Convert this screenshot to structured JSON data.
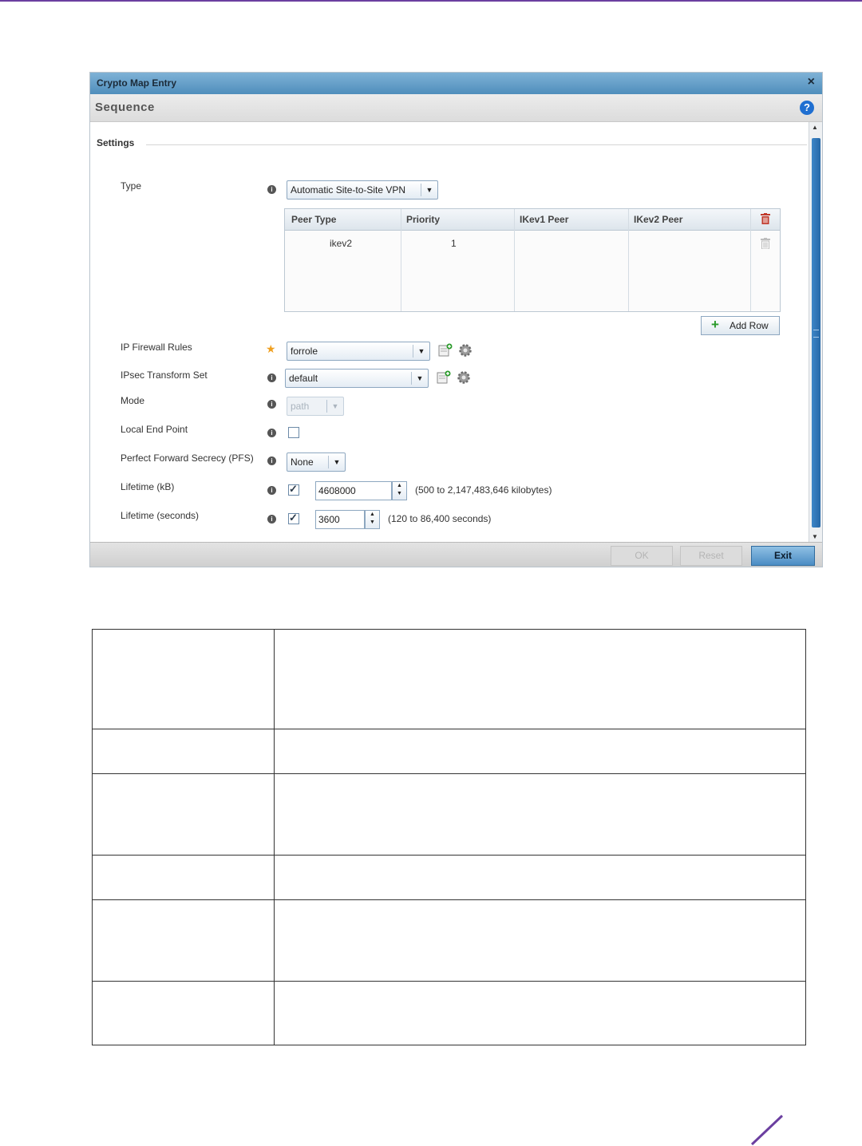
{
  "dialog": {
    "title": "Crypto Map Entry",
    "close_glyph": "×",
    "section_title": "Sequence",
    "help_glyph": "?",
    "settings_legend": "Settings"
  },
  "form": {
    "type": {
      "label": "Type",
      "value": "Automatic Site-to-Site VPN"
    },
    "peer_table": {
      "columns": [
        "Peer Type",
        "Priority",
        "IKev1 Peer",
        "IKev2 Peer"
      ],
      "rows": [
        {
          "peer_type": "ikev2",
          "priority": "1",
          "ikev1_peer": "",
          "ikev2_peer": ""
        }
      ]
    },
    "add_row_label": "Add Row",
    "ip_firewall_rules": {
      "label": "IP Firewall Rules",
      "value": "forrole"
    },
    "ipsec_transform_set": {
      "label": "IPsec Transform Set",
      "value": "default"
    },
    "mode": {
      "label": "Mode",
      "value": "path"
    },
    "local_end_point": {
      "label": "Local End Point",
      "checked": false
    },
    "pfs": {
      "label": "Perfect Forward Secrecy (PFS)",
      "value": "None"
    },
    "lifetime_kb": {
      "label": "Lifetime (kB)",
      "checked": true,
      "value": "4608000",
      "range": "(500 to 2,147,483,646 kilobytes)"
    },
    "lifetime_seconds": {
      "label": "Lifetime (seconds)",
      "checked": true,
      "value": "3600",
      "range": "(120 to 86,400 seconds)"
    }
  },
  "footer": {
    "ok_label": "OK",
    "reset_label": "Reset",
    "exit_label": "Exit"
  },
  "colors": {
    "accent": "#6b3fa0",
    "titlebar": "#4f8ebc",
    "help": "#1f6fd1",
    "trash": "#c0392b"
  },
  "icons": [
    "close-icon",
    "help-icon",
    "info-icon",
    "required-star-icon",
    "dropdown-arrow-icon",
    "trash-icon",
    "plus-icon",
    "create-new-icon",
    "settings-gear-icon",
    "checkbox",
    "spinner-arrows-icon"
  ]
}
